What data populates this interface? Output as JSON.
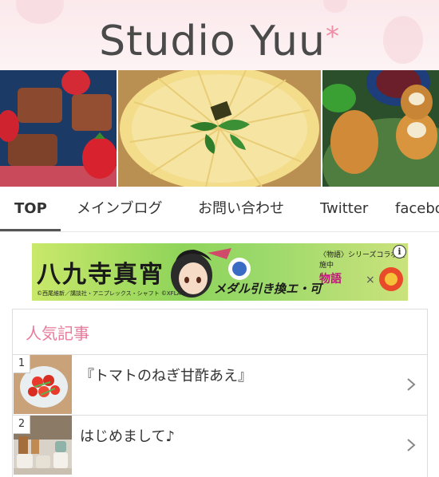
{
  "header": {
    "logo_text": "Studio Yuu",
    "logo_mark": "*"
  },
  "banner": {
    "panels": [
      "chocolate-strawberry-photo",
      "apple-tart-photo",
      "croquette-photo"
    ]
  },
  "nav": {
    "tabs": [
      {
        "label": "TOP",
        "active": true
      },
      {
        "label": "メインブログ",
        "active": false
      },
      {
        "label": "お問い合わせ",
        "active": false
      },
      {
        "label": "Twitter",
        "active": false
      },
      {
        "label": "facebo",
        "active": false
      }
    ]
  },
  "ad": {
    "main_text": "八九寺真宵",
    "sub_text": "メダル引き換エ・可",
    "top_text": "〈物語〉シリーズコラボ実施中",
    "collab_text": "物語",
    "collab_x": "×",
    "small_text": "©西尾維新／講談社・アニプレックス・シャフト ©XFLAG",
    "info_icon": "i"
  },
  "popular": {
    "title": "人気記事",
    "items": [
      {
        "rank": "1",
        "title": "『トマトのねぎ甘酢あえ』"
      },
      {
        "rank": "2",
        "title": "はじめまして♪"
      }
    ]
  },
  "colors": {
    "accent_pink": "#e77b9b",
    "logo_gray": "#4a4a4a"
  }
}
